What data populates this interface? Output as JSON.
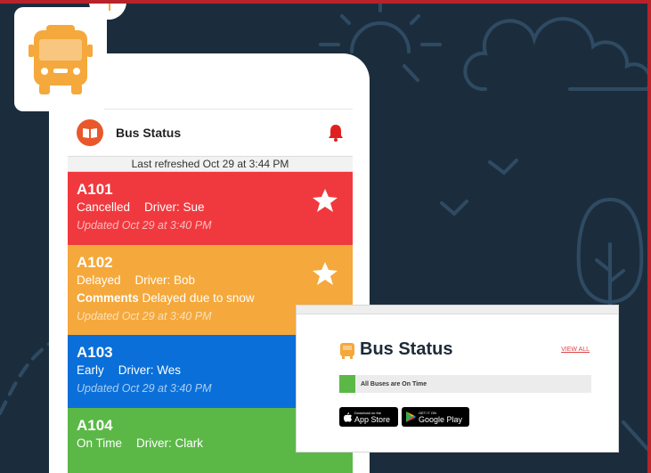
{
  "app": {
    "title": "Bus Status",
    "last_refreshed": "Last refreshed Oct 29 at 3:44 PM"
  },
  "colors": {
    "cancelled": "#f0393e",
    "delayed": "#f5a83b",
    "early": "#0a6fd8",
    "on_time": "#5bb847",
    "background": "#1b2d3c"
  },
  "buses": [
    {
      "route": "A101",
      "status": "Cancelled",
      "driver": "Driver: Sue",
      "updated": "Updated Oct 29 at 3:40 PM",
      "starred": true
    },
    {
      "route": "A102",
      "status": "Delayed",
      "driver": "Driver: Bob",
      "comments_label": "Comments",
      "comments": "Delayed due to snow",
      "updated": "Updated Oct 29 at 3:40 PM",
      "starred": true
    },
    {
      "route": "A103",
      "status": "Early",
      "driver": "Driver: Wes",
      "updated": "Updated Oct 29 at 3:40 PM",
      "starred": false
    },
    {
      "route": "A104",
      "status": "On Time",
      "driver": "Driver: Clark",
      "starred": false
    }
  ],
  "widget": {
    "title": "Bus Status",
    "view_all": "VIEW ALL",
    "status_text": "All Buses are On Time",
    "app_store": {
      "small": "Download on the",
      "big": "App Store"
    },
    "google_play": {
      "small": "GET IT ON",
      "big": "Google Play"
    }
  }
}
